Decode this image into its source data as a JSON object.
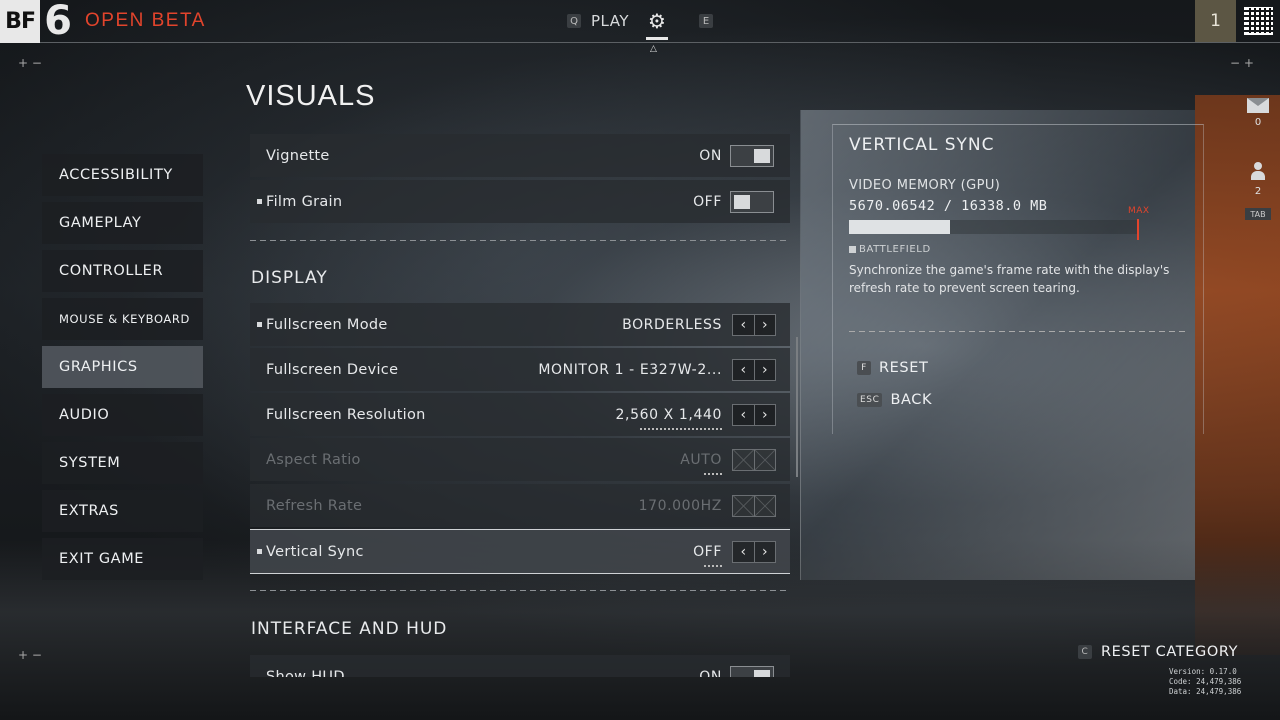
{
  "header": {
    "logo_bf": "BF",
    "logo_six": "6",
    "title": "OPEN BETA",
    "nav_key_left": "Q",
    "play_label": "PLAY",
    "nav_key_right": "E",
    "player_level": "1"
  },
  "page": {
    "title": "VISUALS"
  },
  "sidebar": {
    "items": [
      {
        "label": "ACCESSIBILITY"
      },
      {
        "label": "GAMEPLAY"
      },
      {
        "label": "CONTROLLER"
      },
      {
        "label": "MOUSE & KEYBOARD"
      },
      {
        "label": "GRAPHICS",
        "active": true
      },
      {
        "label": "AUDIO"
      },
      {
        "label": "SYSTEM"
      },
      {
        "label": "EXTRAS"
      },
      {
        "label": "EXIT GAME"
      }
    ]
  },
  "settings": {
    "vignette": {
      "label": "Vignette",
      "value": "ON"
    },
    "film_grain": {
      "label": "Film Grain",
      "value": "OFF"
    },
    "display_section": "DISPLAY",
    "fullscreen_mode": {
      "label": "Fullscreen Mode",
      "value": "BORDERLESS"
    },
    "fullscreen_device": {
      "label": "Fullscreen Device",
      "value": "MONITOR 1 - E327W-2..."
    },
    "fullscreen_resolution": {
      "label": "Fullscreen Resolution",
      "value": "2,560 X 1,440"
    },
    "aspect_ratio": {
      "label": "Aspect Ratio",
      "value": "AUTO"
    },
    "refresh_rate": {
      "label": "Refresh Rate",
      "value": "170.000HZ"
    },
    "vertical_sync": {
      "label": "Vertical Sync",
      "value": "OFF"
    },
    "interface_section": "INTERFACE AND HUD",
    "show_hud": {
      "label": "Show HUD",
      "value": "ON"
    }
  },
  "info": {
    "title": "VERTICAL SYNC",
    "vm_label": "VIDEO MEMORY (GPU)",
    "vm_value": "5670.06542 / 16338.0 MB",
    "vm_fraction": 0.347,
    "max_label": "MAX",
    "tag": "BATTLEFIELD",
    "description": "Synchronize the game's frame rate with the display's refresh rate to prevent screen tearing.",
    "reset_key": "F",
    "reset_label": "RESET",
    "back_key": "ESC",
    "back_label": "BACK"
  },
  "edge": {
    "mail_count": "0",
    "party_count": "2",
    "tab_key": "TAB"
  },
  "footer": {
    "reset_key": "C",
    "reset_category": "RESET CATEGORY",
    "version": "Version: 0.17.0",
    "code": "Code: 24,479,386",
    "data": "Data: 24,479,386"
  },
  "colors": {
    "accent": "#e2442c",
    "level_badge": "#5c5644"
  }
}
